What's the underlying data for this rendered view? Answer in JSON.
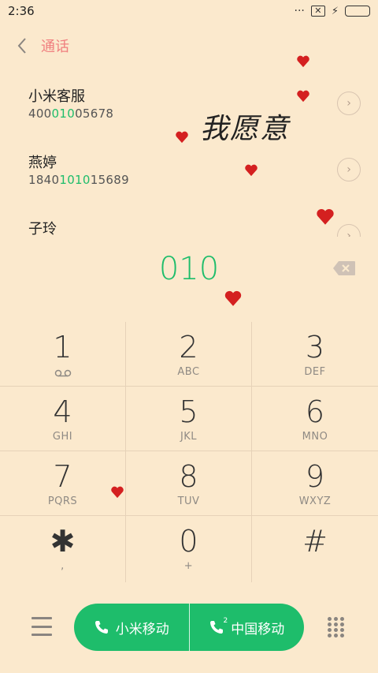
{
  "status_bar": {
    "time": "2:36",
    "dots": "···",
    "sim_icon": "✕"
  },
  "header": {
    "title": "通话",
    "back_icon": "chevron-left"
  },
  "contacts": [
    {
      "name": "小米客服",
      "number_pre": "400",
      "number_hl": "010",
      "number_post": "05678"
    },
    {
      "name": "燕婷",
      "number_pre": "1840",
      "number_hl": "1010",
      "number_post": "15689"
    },
    {
      "name": "子玲",
      "number_pre": "",
      "number_hl": "",
      "number_post": ""
    }
  ],
  "decor": {
    "wallpaper_text": "我愿意",
    "heart_color": "#d42020"
  },
  "dial_input": {
    "value": "010"
  },
  "keypad": [
    {
      "digit": "1",
      "sub": ""
    },
    {
      "digit": "2",
      "sub": "ABC"
    },
    {
      "digit": "3",
      "sub": "DEF"
    },
    {
      "digit": "4",
      "sub": "GHI"
    },
    {
      "digit": "5",
      "sub": "JKL"
    },
    {
      "digit": "6",
      "sub": "MNO"
    },
    {
      "digit": "7",
      "sub": "PQRS"
    },
    {
      "digit": "8",
      "sub": "TUV"
    },
    {
      "digit": "9",
      "sub": "WXYZ"
    },
    {
      "digit": "✱",
      "sub": ","
    },
    {
      "digit": "0",
      "sub": "+"
    },
    {
      "digit": "#",
      "sub": ""
    }
  ],
  "call_buttons": [
    {
      "label": "小米移动",
      "sim": ""
    },
    {
      "label": "中国移动",
      "sim": "2"
    }
  ],
  "colors": {
    "accent": "#1ebd6b",
    "title": "#f07f7f",
    "background": "#fbe9cd"
  }
}
